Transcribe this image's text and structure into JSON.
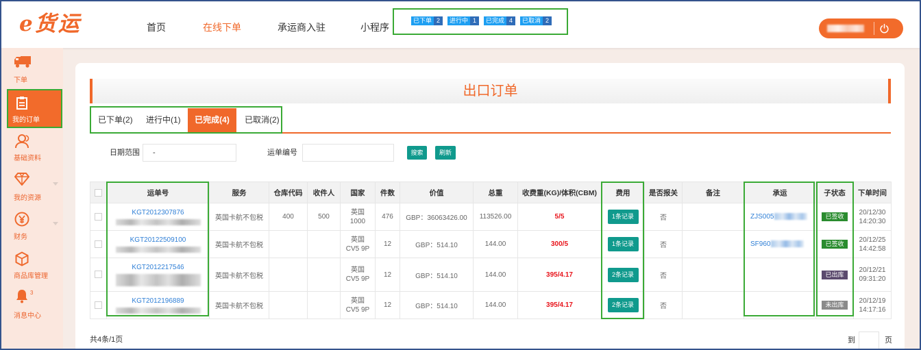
{
  "brand": {
    "logo": "e货运"
  },
  "nav": {
    "items": [
      {
        "label": "首页"
      },
      {
        "label": "在线下单",
        "active": true
      },
      {
        "label": "承运商入驻"
      },
      {
        "label": "小程序"
      }
    ]
  },
  "order_badges": [
    {
      "label": "已下单",
      "count": "2"
    },
    {
      "label": "进行中",
      "count": "1"
    },
    {
      "label": "已完成",
      "count": "4"
    },
    {
      "label": "已取消",
      "count": "2"
    }
  ],
  "user_menu": {
    "logout_icon": "power-icon"
  },
  "sidebar": {
    "items": [
      {
        "label": "下单",
        "icon": "truck-icon"
      },
      {
        "label": "我的订单",
        "icon": "clipboard-icon",
        "active": true
      },
      {
        "label": "基础资料",
        "icon": "user-icon"
      },
      {
        "label": "我的资源",
        "icon": "diamond-icon",
        "expandable": true
      },
      {
        "label": "财务",
        "icon": "yen-icon",
        "expandable": true
      },
      {
        "label": "商品库管理",
        "icon": "box-icon"
      },
      {
        "label": "消息中心",
        "icon": "bell-icon",
        "badge": "3"
      }
    ]
  },
  "page": {
    "title": "出口订单"
  },
  "tabs": [
    {
      "label": "已下单(2)"
    },
    {
      "label": "进行中(1)"
    },
    {
      "label": "已完成(4)",
      "active": true
    },
    {
      "label": "已取消(2)"
    }
  ],
  "filters": {
    "date_label": "日期范围",
    "date_value": "-",
    "waybill_label": "运单编号",
    "waybill_value": "",
    "search_label": "搜索",
    "refresh_label": "刷新"
  },
  "table": {
    "headers": [
      "运单号",
      "服务",
      "仓库代码",
      "收件人",
      "国家",
      "件数",
      "价值",
      "总重",
      "收费重(KG)/体积(CBM)",
      "费用",
      "是否报关",
      "备注",
      "承运",
      "子状态",
      "下单时间"
    ],
    "rows": [
      {
        "waybill": "KGT2012307876",
        "service": "英国卡航不包税",
        "warehouse": "400",
        "recipient": "500",
        "country": "英国",
        "postcode": "1000",
        "pieces": "476",
        "value": "GBP：36063426.00",
        "weight": "113526.00",
        "charge": "5/5",
        "fee": "1条记录",
        "customs": "否",
        "remark": "",
        "carrier": "ZJS005",
        "status": "已签收",
        "status_color": "#2a8c2f",
        "date": "20/12/30",
        "time": "14:20:30"
      },
      {
        "waybill": "KGT20122509100",
        "service": "英国卡航不包税",
        "warehouse": "",
        "recipient": "",
        "country": "英国",
        "postcode": "CV5 9P",
        "pieces": "12",
        "value": "GBP：514.10",
        "weight": "144.00",
        "charge": "300/5",
        "fee": "1条记录",
        "customs": "否",
        "remark": "",
        "carrier": "SF960",
        "status": "已签收",
        "status_color": "#2a8c2f",
        "date": "20/12/25",
        "time": "14:42:58"
      },
      {
        "waybill": "KGT2012217546",
        "service": "英国卡航不包税",
        "warehouse": "",
        "recipient": "",
        "country": "英国",
        "postcode": "CV5 9P",
        "pieces": "12",
        "value": "GBP：514.10",
        "weight": "144.00",
        "charge": "395/4.17",
        "fee": "2条记录",
        "customs": "否",
        "remark": "",
        "carrier": "",
        "status": "已出库",
        "status_color": "#5b4a6e",
        "date": "20/12/21",
        "time": "09:31:20"
      },
      {
        "waybill": "KGT2012196889",
        "service": "英国卡航不包税",
        "warehouse": "",
        "recipient": "",
        "country": "英国",
        "postcode": "CV5 9P",
        "pieces": "12",
        "value": "GBP：514.10",
        "weight": "144.00",
        "charge": "395/4.17",
        "fee": "2条记录",
        "customs": "否",
        "remark": "",
        "carrier": "",
        "status": "未出库",
        "status_color": "#8a8a8a",
        "date": "20/12/19",
        "time": "14:17:16"
      }
    ]
  },
  "footer": {
    "summary": "共4条/1页",
    "goto_prefix": "到",
    "goto_value": "",
    "goto_suffix": "页"
  },
  "colors": {
    "brand_orange": "#f0682a",
    "teal": "#109a8d",
    "link_blue": "#2f7fd6",
    "highlight_green": "#3aaa35",
    "badge_blue": "#1e9ff2",
    "badge_blue_dark": "#2f6cb8",
    "sidebar_bg": "#fbe7de"
  }
}
